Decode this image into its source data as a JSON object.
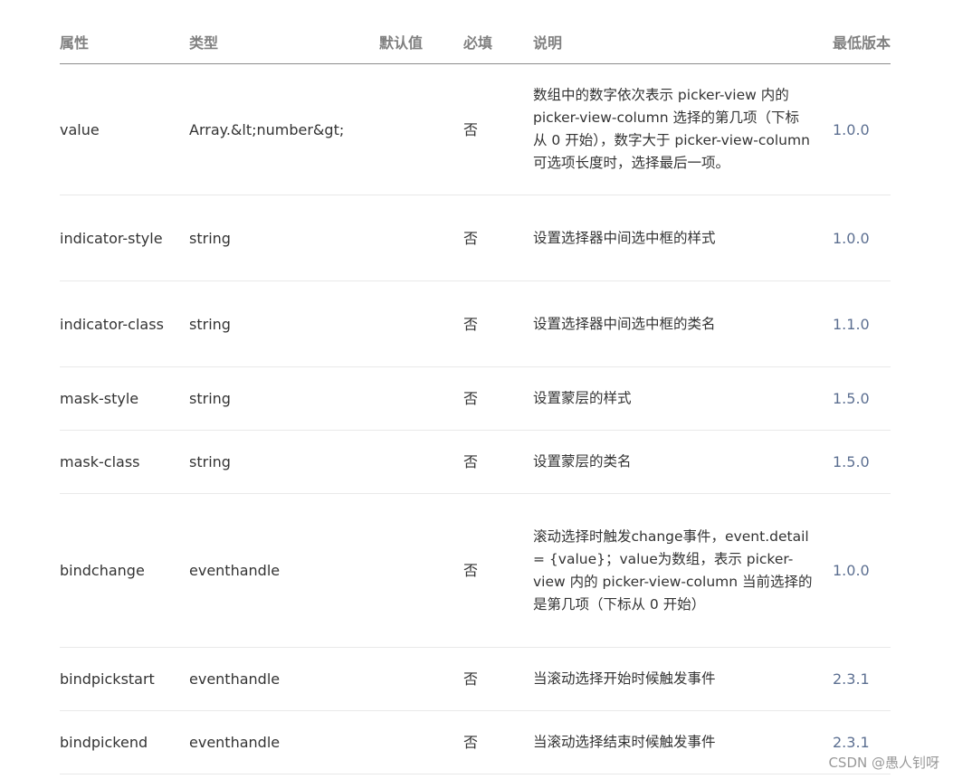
{
  "table": {
    "headers": {
      "attr": "属性",
      "type": "类型",
      "default": "默认值",
      "required": "必填",
      "description": "说明",
      "version": "最低版本"
    },
    "rows": [
      {
        "attr": "value",
        "type": "Array.&lt;number&gt;",
        "default": "",
        "required": "否",
        "description": "数组中的数字依次表示 picker-view 内的 picker-view-column 选择的第几项（下标从 0 开始），数字大于 picker-view-column 可选项长度时，选择最后一项。",
        "version": "1.0.0"
      },
      {
        "attr": "indicator-style",
        "type": "string",
        "default": "",
        "required": "否",
        "description": "设置选择器中间选中框的样式",
        "version": "1.0.0"
      },
      {
        "attr": "indicator-class",
        "type": "string",
        "default": "",
        "required": "否",
        "description": "设置选择器中间选中框的类名",
        "version": "1.1.0"
      },
      {
        "attr": "mask-style",
        "type": "string",
        "default": "",
        "required": "否",
        "description": "设置蒙层的样式",
        "version": "1.5.0"
      },
      {
        "attr": "mask-class",
        "type": "string",
        "default": "",
        "required": "否",
        "description": "设置蒙层的类名",
        "version": "1.5.0"
      },
      {
        "attr": "bindchange",
        "type": "eventhandle",
        "default": "",
        "required": "否",
        "description": "滚动选择时触发change事件，event.detail = {value}；value为数组，表示 picker-view 内的 picker-view-column 当前选择的是第几项（下标从 0 开始）",
        "version": "1.0.0"
      },
      {
        "attr": "bindpickstart",
        "type": "eventhandle",
        "default": "",
        "required": "否",
        "description": "当滚动选择开始时候触发事件",
        "version": "2.3.1"
      },
      {
        "attr": "bindpickend",
        "type": "eventhandle",
        "default": "",
        "required": "否",
        "description": "当滚动选择结束时候触发事件",
        "version": "2.3.1"
      }
    ]
  },
  "watermark": "CSDN @愚人钊呀"
}
